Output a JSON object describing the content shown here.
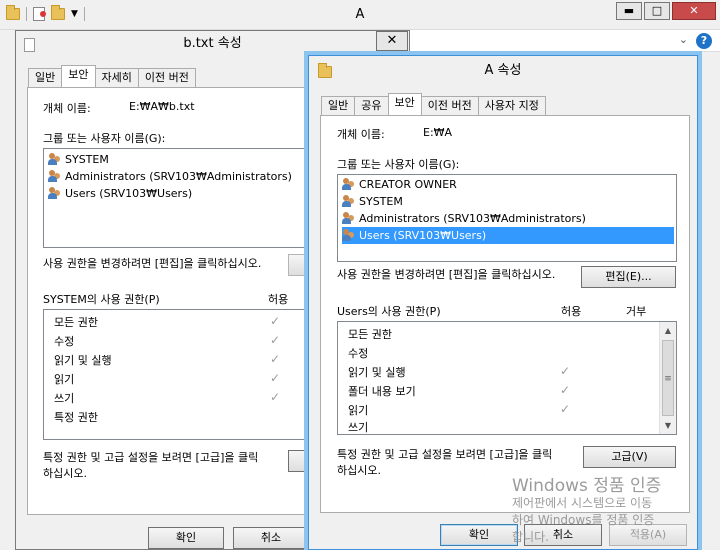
{
  "explorer": {
    "title": "A",
    "minimize_glyph": "▬",
    "maximize_glyph": "□",
    "close_glyph": "✕",
    "help_glyph": "?",
    "dropdown_glyph": "⌄"
  },
  "dialog_b": {
    "title": "b.txt 속성",
    "close_glyph": "✕",
    "tabs": [
      "일반",
      "보안",
      "자세히",
      "이전 버전"
    ],
    "object_label": "개체 이름:",
    "object_value": "E:₩A₩b.txt",
    "group_label": "그룹 또는 사용자 이름(G):",
    "users": [
      "SYSTEM",
      "Administrators (SRV103₩Administrators)",
      "Users (SRV103₩Users)"
    ],
    "change_text": "사용 권한을 변경하려면 [편집]을 클릭하십시오.",
    "perm_header": "SYSTEM의 사용 권한(P)",
    "allow_header": "허용",
    "permissions": [
      "모든 권한",
      "수정",
      "읽기 및 실행",
      "읽기",
      "쓰기",
      "특정 권한"
    ],
    "advanced_text_1": "특정 권한 및 고급 설정을 보려면 [고급]을 클릭",
    "advanced_text_2": "하십시오.",
    "ok": "확인",
    "cancel": "취소",
    "check_glyph": "✓"
  },
  "dialog_a": {
    "title": "A 속성",
    "tabs": [
      "일반",
      "공유",
      "보안",
      "이전 버전",
      "사용자 지정"
    ],
    "object_label": "개체 이름:",
    "object_value": "E:₩A",
    "group_label": "그룹 또는 사용자 이름(G):",
    "users": [
      "CREATOR OWNER",
      "SYSTEM",
      "Administrators (SRV103₩Administrators)",
      "Users (SRV103₩Users)"
    ],
    "change_text": "사용 권한을 변경하려면 [편집]을 클릭하십시오.",
    "edit_button": "편집(E)...",
    "perm_header": "Users의 사용 권한(P)",
    "allow_header": "허용",
    "deny_header": "거부",
    "permissions": [
      "모든 권한",
      "수정",
      "읽기 및 실행",
      "폴더 내용 보기",
      "읽기",
      "쓰기"
    ],
    "advanced_text_1": "특정 권한 및 고급 설정을 보려면 [고급]을 클릭",
    "advanced_text_2": "하십시오.",
    "advanced_button": "고급(V)",
    "ok": "확인",
    "cancel": "취소",
    "apply": "적용(A)",
    "check_glyph": "✓"
  },
  "watermark": {
    "line1": "Windows 정품 인증",
    "line2": "제어판에서 시스템으로 이동",
    "line3": "하여 Windows를 정품 인증",
    "line4": "합니다."
  }
}
